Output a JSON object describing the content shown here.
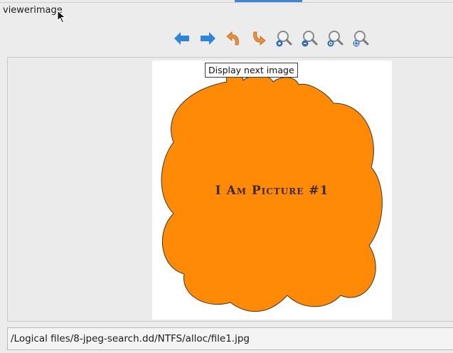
{
  "panel": {
    "title": "viewerimage"
  },
  "toolbar": {
    "buttons": [
      {
        "name": "previous-image",
        "icon": "arrow-left-icon"
      },
      {
        "name": "next-image",
        "icon": "arrow-right-icon"
      },
      {
        "name": "rotate-left",
        "icon": "rotate-left-icon"
      },
      {
        "name": "rotate-right",
        "icon": "rotate-right-icon"
      },
      {
        "name": "zoom-in",
        "icon": "zoom-in-icon"
      },
      {
        "name": "zoom-out",
        "icon": "zoom-out-icon"
      },
      {
        "name": "zoom-reset",
        "icon": "zoom-reset-icon"
      },
      {
        "name": "zoom-fit",
        "icon": "zoom-fit-icon"
      }
    ],
    "tooltip": "Display next image"
  },
  "image": {
    "caption": "I Am Picture #1",
    "fill_color": "#ff8a05"
  },
  "path": {
    "value": "/Logical files/8-jpeg-search.dd/NTFS/alloc/file1.jpg"
  },
  "colors": {
    "accent": "#3f87d6",
    "arrow": "#2f86d8",
    "rotate": "#e8923a"
  }
}
